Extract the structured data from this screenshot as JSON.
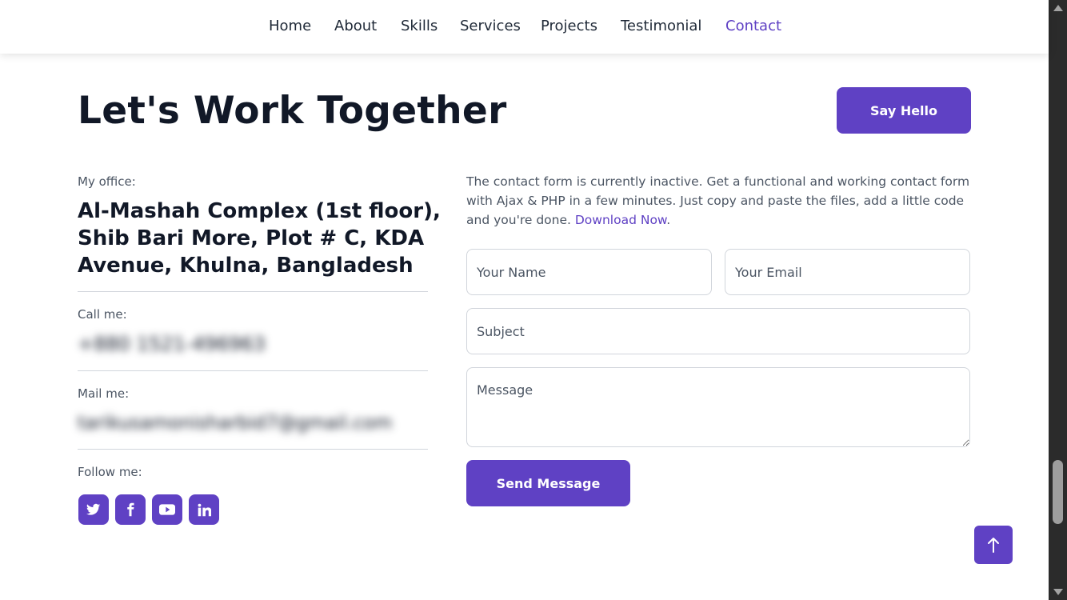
{
  "nav": {
    "items": [
      {
        "label": "Home"
      },
      {
        "label": "About"
      },
      {
        "label": "Skills"
      },
      {
        "label": "Services"
      },
      {
        "label": "Projects"
      },
      {
        "label": "Testimonial"
      },
      {
        "label": "Contact"
      }
    ],
    "active": "Contact"
  },
  "hero": {
    "title": "Let's Work Together",
    "say_hello_label": "Say Hello"
  },
  "info": {
    "office_label": "My office:",
    "office_address": "Al-Mashah Complex (1st floor), Shib Bari More, Plot # C, KDA Avenue, Khulna, Bangladesh",
    "call_label": "Call me:",
    "call_value": "+880 1521-496963",
    "mail_label": "Mail me:",
    "mail_value": "tarikusamonisharbid7@gmail.com",
    "follow_label": "Follow me:",
    "socials": [
      "twitter-icon",
      "facebook-icon",
      "youtube-icon",
      "linkedin-icon"
    ]
  },
  "form": {
    "intro_text": "The contact form is currently inactive. Get a functional and working contact form with Ajax & PHP in a few minutes. Just copy and paste the files, add a little code and you're done. ",
    "download_link": "Download Now",
    "intro_end": ".",
    "name_placeholder": "Your Name",
    "email_placeholder": "Your Email",
    "subject_placeholder": "Subject",
    "message_placeholder": "Message",
    "send_label": "Send Message"
  },
  "colors": {
    "accent": "#5f41c4",
    "text": "#111827",
    "muted": "#4b5563"
  },
  "icons": {
    "back_to_top": "arrow-up-icon"
  }
}
